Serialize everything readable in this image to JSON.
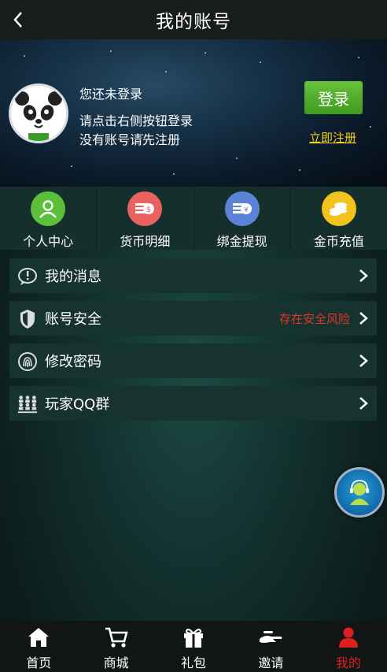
{
  "header": {
    "title": "我的账号",
    "back_icon": "back-arrow-icon"
  },
  "banner": {
    "status": "您还未登录",
    "hint_line1": "请点击右侧按钮登录",
    "hint_line2": "没有账号请先注册",
    "login_label": "登录",
    "register_label": "立即注册",
    "avatar_icon": "panda-avatar"
  },
  "quick": [
    {
      "label": "个人中心",
      "icon": "person-icon",
      "color": "#5cbf3a"
    },
    {
      "label": "货币明细",
      "icon": "money-stack-icon",
      "color": "#e8635f"
    },
    {
      "label": "绑金提现",
      "icon": "withdraw-icon",
      "color": "#5b84d8"
    },
    {
      "label": "金币充值",
      "icon": "coins-icon",
      "color": "#f3c31d"
    }
  ],
  "menu": [
    {
      "label": "我的消息",
      "icon": "message-icon",
      "warning": ""
    },
    {
      "label": "账号安全",
      "icon": "shield-icon",
      "warning": "存在安全风险"
    },
    {
      "label": "修改密码",
      "icon": "fingerprint-icon",
      "warning": ""
    },
    {
      "label": "玩家QQ群",
      "icon": "group-icon",
      "warning": ""
    }
  ],
  "tabbar": [
    {
      "label": "首页",
      "icon": "home-icon",
      "active": false
    },
    {
      "label": "商城",
      "icon": "cart-icon",
      "active": false
    },
    {
      "label": "礼包",
      "icon": "gift-icon",
      "active": false
    },
    {
      "label": "邀请",
      "icon": "invite-icon",
      "active": false
    },
    {
      "label": "我的",
      "icon": "user-icon",
      "active": true
    }
  ],
  "colors": {
    "accent": "#e02020",
    "login_green": "#4fae2a",
    "link_yellow": "#f2d21c",
    "warning_red": "#e4332a"
  }
}
